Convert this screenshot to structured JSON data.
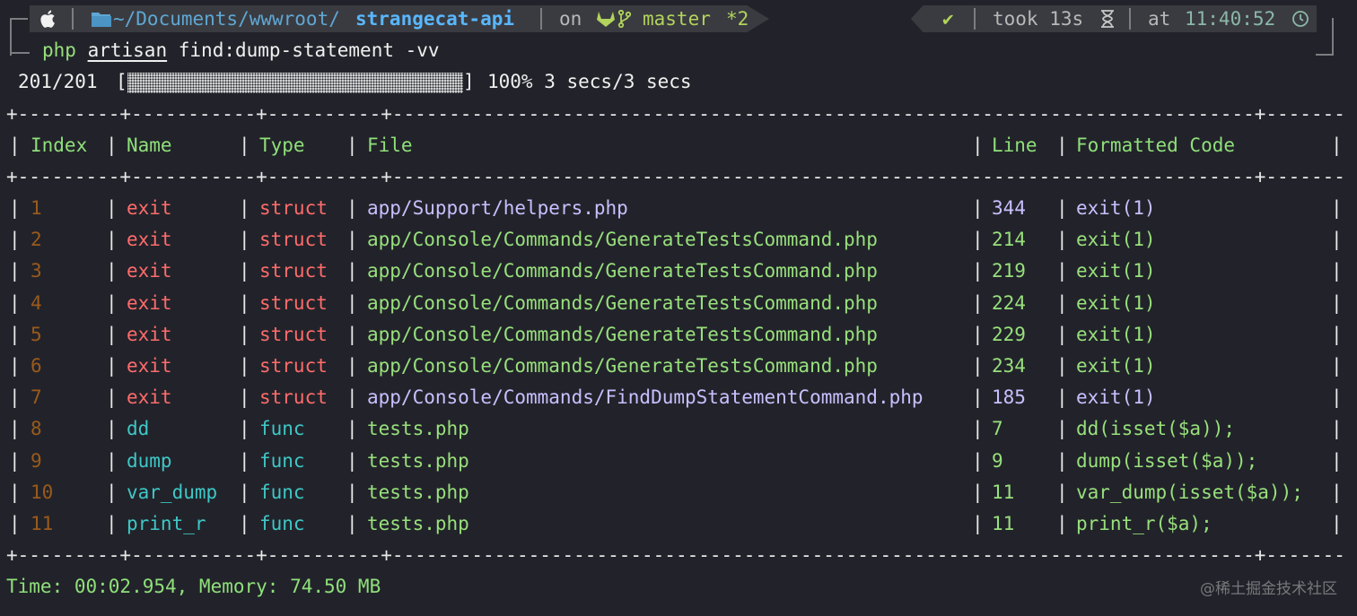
{
  "prompt": {
    "os_icon": "apple-icon",
    "folder_icon": "folder-icon",
    "path_prefix": "~/Documents/wwwroot/",
    "path_current": "strangecat-api",
    "on_label": "on",
    "vcs_icons": "gitlab-branch-icon",
    "branch": "master",
    "branch_status": "*2",
    "success_mark": "✔",
    "took_label": "took 13s",
    "hourglass": "⌛",
    "at_label": "at",
    "clock_time": "11:40:52",
    "clock_icon": "clock-icon"
  },
  "command": {
    "php": "php",
    "artisan": "artisan",
    "rest": "find:dump-statement -vv"
  },
  "progress": {
    "count": "201/201",
    "open_bracket": "[",
    "close_bracket": "]",
    "fraction": 1.0,
    "summary": "100% 3 secs/3 secs"
  },
  "table": {
    "border_line": "+---------+-----------+----------+----------------------------------------------------------------------------+---------+---------------------------------------------------------+",
    "headers": [
      "Index",
      "Name",
      "Type",
      "File",
      "Line",
      "Formatted Code"
    ],
    "rows": [
      [
        "1",
        "exit",
        "struct",
        "app/Support/helpers.php",
        "344",
        "exit(1)"
      ],
      [
        "2",
        "exit",
        "struct",
        "app/Console/Commands/GenerateTestsCommand.php",
        "214",
        "exit(1)"
      ],
      [
        "3",
        "exit",
        "struct",
        "app/Console/Commands/GenerateTestsCommand.php",
        "219",
        "exit(1)"
      ],
      [
        "4",
        "exit",
        "struct",
        "app/Console/Commands/GenerateTestsCommand.php",
        "224",
        "exit(1)"
      ],
      [
        "5",
        "exit",
        "struct",
        "app/Console/Commands/GenerateTestsCommand.php",
        "229",
        "exit(1)"
      ],
      [
        "6",
        "exit",
        "struct",
        "app/Console/Commands/GenerateTestsCommand.php",
        "234",
        "exit(1)"
      ],
      [
        "7",
        "exit",
        "struct",
        "app/Console/Commands/FindDumpStatementCommand.php",
        "185",
        "exit(1)"
      ],
      [
        "8",
        "dd",
        "func",
        "tests.php",
        "7",
        "dd(isset($a));"
      ],
      [
        "9",
        "dump",
        "func",
        "tests.php",
        "9",
        "dump(isset($a));"
      ],
      [
        "10",
        "var_dump",
        "func",
        "tests.php",
        "11",
        "var_dump(isset($a));"
      ],
      [
        "11",
        "print_r",
        "func",
        "tests.php",
        "11",
        "print_r($a);"
      ]
    ]
  },
  "footer": {
    "stats": "Time: 00:02.954, Memory: 74.50 MB"
  },
  "watermark": "@稀土掘金技术社区"
}
